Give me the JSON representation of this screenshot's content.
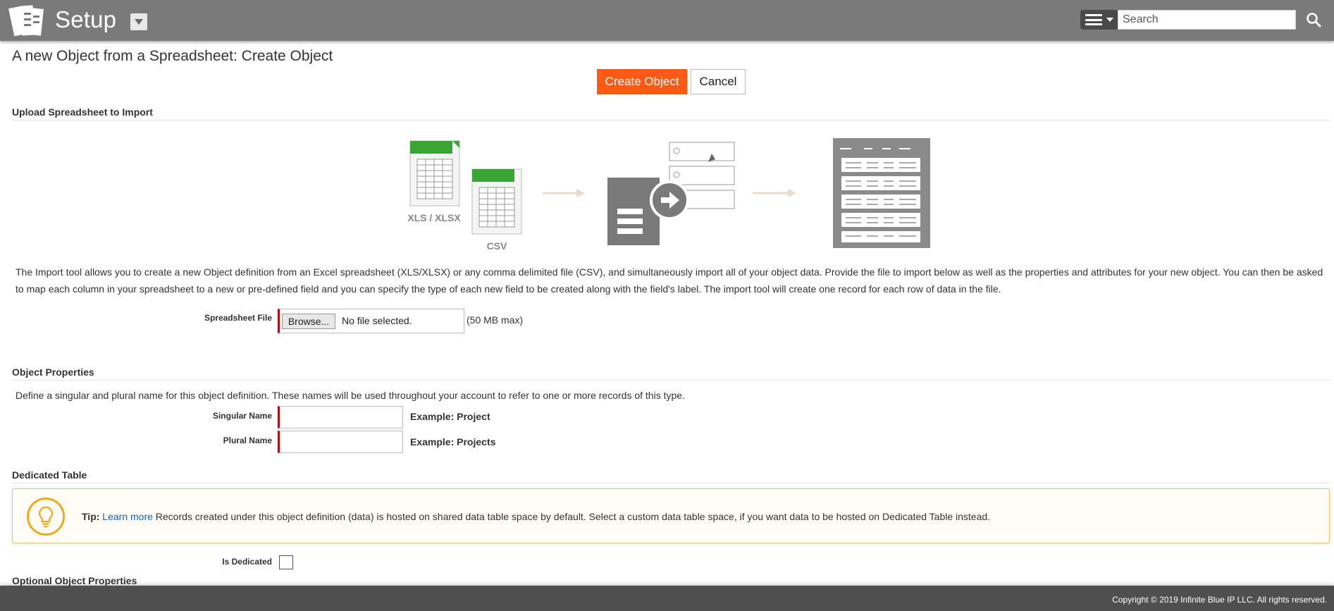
{
  "header": {
    "app_title": "Setup",
    "search_placeholder": "Search"
  },
  "page": {
    "title": "A new Object from a Spreadsheet: Create Object",
    "create_button": "Create Object",
    "cancel_button": "Cancel"
  },
  "upload": {
    "section_title": "Upload Spreadsheet to Import",
    "illustration": {
      "xls_label": "XLS / XLSX",
      "csv_label": "CSV"
    },
    "description": "The Import tool allows you to create a new Object definition from an Excel spreadsheet (XLS/XLSX) or any comma delimited file (CSV), and simultaneously import all of your object data. Provide the file to import below as well as the properties and attributes for your new object. You can then be asked to map each column in your spreadsheet to a new or pre-defined field and you can specify the type of each new field to be created along with the field's label. The import tool will create one record for each row of data in the file.",
    "file_label": "Spreadsheet File",
    "browse_label": "Browse...",
    "no_file_text": "No file selected.",
    "max_hint": "(50 MB max)"
  },
  "object_properties": {
    "section_title": "Object Properties",
    "description": "Define a singular and plural name for this object definition. These names will be used throughout your account to refer to one or more records of this type.",
    "singular_label": "Singular Name",
    "singular_value": "",
    "singular_example": "Example: Project",
    "plural_label": "Plural Name",
    "plural_value": "",
    "plural_example": "Example: Projects"
  },
  "dedicated_table": {
    "section_title": "Dedicated Table",
    "tip_prefix": "Tip:",
    "tip_link": "Learn more",
    "tip_text": " Records created under this object definition (data) is hosted on shared data table space by default. Select a custom data table space, if you want data to be hosted on Dedicated Table instead.",
    "is_dedicated_label": "Is Dedicated",
    "is_dedicated_checked": false
  },
  "optional": {
    "section_title": "Optional Object Properties"
  },
  "footer": {
    "copyright": "Copyright © 2019 Infinite Blue IP LLC. All rights reserved."
  },
  "colors": {
    "header_bg": "#7a7a7a",
    "primary_button": "#ff5a14",
    "required_marker": "#aa1111",
    "tip_border": "#f0c36d",
    "tip_icon": "#f0a81e",
    "link": "#1a5fb4",
    "footer_bg": "#4f4f4f"
  }
}
